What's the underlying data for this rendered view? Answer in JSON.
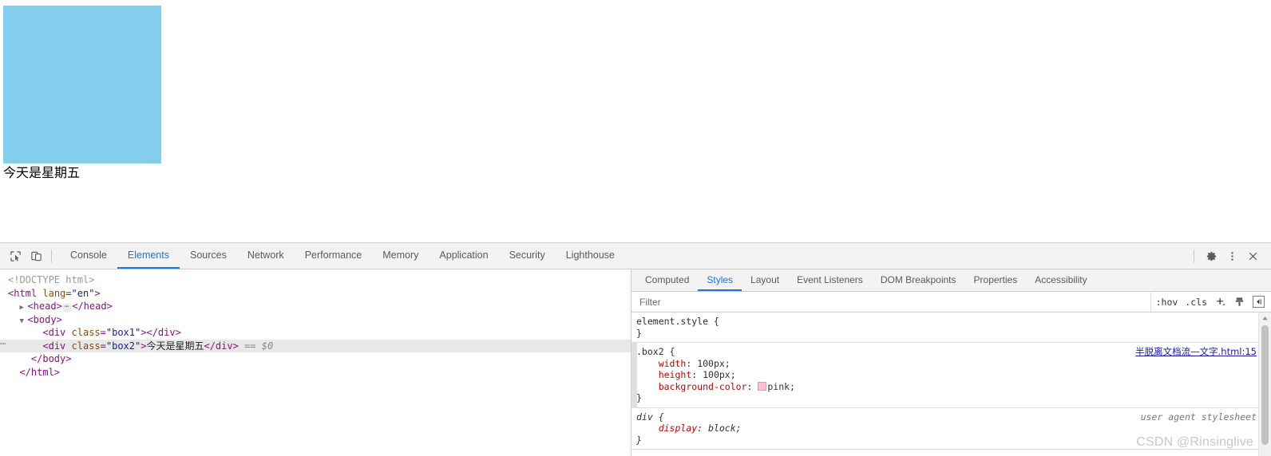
{
  "page": {
    "box1": {
      "name": "box1",
      "color": "#83ceec"
    },
    "box2": {
      "name": "box2",
      "text": "今天是星期五",
      "color": "#ffc0cb"
    }
  },
  "devtools": {
    "left_tools": [
      {
        "name": "inspect-element-icon",
        "label": "Inspect element"
      },
      {
        "name": "device-toolbar-icon",
        "label": "Toggle device toolbar"
      }
    ],
    "tabs": [
      {
        "label": "Console",
        "active": false
      },
      {
        "label": "Elements",
        "active": true
      },
      {
        "label": "Sources",
        "active": false
      },
      {
        "label": "Network",
        "active": false
      },
      {
        "label": "Performance",
        "active": false
      },
      {
        "label": "Memory",
        "active": false
      },
      {
        "label": "Application",
        "active": false
      },
      {
        "label": "Security",
        "active": false
      },
      {
        "label": "Lighthouse",
        "active": false
      }
    ],
    "right_icons": [
      {
        "name": "gear-icon",
        "label": "Settings"
      },
      {
        "name": "kebab-menu-icon",
        "label": "Customize and control DevTools"
      },
      {
        "name": "close-icon",
        "label": "Close DevTools"
      }
    ],
    "dom_tree": {
      "doctype": "<!DOCTYPE html>",
      "html_open": "<html lang=\"en\">",
      "head_line": "<head>",
      "head_close": "</head>",
      "body_open": "<body>",
      "div_box1": "<div class=\"box1\"></div>",
      "div_box2_tag_open": "<div class=\"box2\">",
      "div_box2_text": "今天是星期五",
      "div_box2_tag_close": "</div>",
      "selected_marker": "== $0",
      "body_close": "</body>",
      "html_close": "</html>",
      "attr_class": "class",
      "attr_lang": "lang",
      "val_box1": "\"box1\"",
      "val_box2": "\"box2\"",
      "val_en": "\"en\""
    },
    "styles_panel": {
      "tabs": [
        {
          "label": "Computed",
          "active": false
        },
        {
          "label": "Styles",
          "active": true
        },
        {
          "label": "Layout",
          "active": false
        },
        {
          "label": "Event Listeners",
          "active": false
        },
        {
          "label": "DOM Breakpoints",
          "active": false
        },
        {
          "label": "Properties",
          "active": false
        },
        {
          "label": "Accessibility",
          "active": false
        }
      ],
      "filter_placeholder": "Filter",
      "filter_value": "",
      "actions": [
        {
          "name": "hov-button",
          "label": ":hov"
        },
        {
          "name": "cls-button",
          "label": ".cls"
        },
        {
          "name": "new-style-rule-button",
          "label": "+"
        },
        {
          "name": "computed-styles-sidebar-button",
          "label": ""
        },
        {
          "name": "toggle-sidebar-button",
          "label": ""
        }
      ],
      "rules": [
        {
          "name": "element-style-rule",
          "selector": "element.style {",
          "close": "}",
          "origin": "",
          "origin_kind": "none",
          "declarations": []
        },
        {
          "name": "box2-rule",
          "selector": ".box2 {",
          "close": "}",
          "origin": "半脱离文档流—文字.html:15",
          "origin_kind": "link",
          "matched": true,
          "declarations": [
            {
              "prop": "width",
              "value": "100px;",
              "swatch": ""
            },
            {
              "prop": "height",
              "value": "100px;",
              "swatch": ""
            },
            {
              "prop": "background-color",
              "value": "pink;",
              "swatch": "#ffc0cb"
            }
          ]
        },
        {
          "name": "user-agent-div-rule",
          "selector": "div {",
          "close": "}",
          "origin": "user agent stylesheet",
          "origin_kind": "text",
          "ua": true,
          "declarations": [
            {
              "prop": "display",
              "value": "block;",
              "swatch": ""
            }
          ]
        }
      ]
    },
    "watermark": "CSDN @Rinsinglive"
  }
}
